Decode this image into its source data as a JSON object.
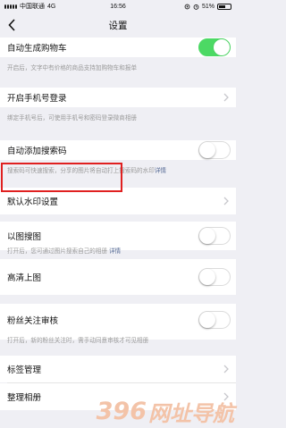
{
  "status": {
    "carrier": "中国联通",
    "network": "4G",
    "time": "16:56",
    "battery": "51%"
  },
  "nav": {
    "title": "设置"
  },
  "settings": [
    {
      "label": "自动生成购物车",
      "desc": "开启后，文字中有价格的商品支持加购物车和报单",
      "control": "toggle",
      "on": true
    },
    {
      "label": "开启手机号登录",
      "desc": "绑定手机号后，可使用手机号和密码登录微商相册",
      "control": "chevron"
    },
    {
      "label": "自动添加搜索码",
      "desc": "搜索码可快速搜索，分享的图片将自动打上搜索码的水印",
      "link": "详情",
      "control": "toggle",
      "on": false
    },
    {
      "label": "默认水印设置",
      "control": "chevron",
      "highlighted": true
    },
    {
      "label": "以图搜图",
      "desc": "打开后，您可通过图片搜索自己的相册",
      "link": "详情",
      "control": "toggle",
      "on": false
    },
    {
      "label": "高清上图",
      "control": "toggle",
      "on": false
    },
    {
      "label": "粉丝关注审核",
      "desc": "打开后，新的粉丝关注时，需手动同意审核才可见相册",
      "control": "toggle",
      "on": false
    },
    {
      "label": "标签管理",
      "control": "chevron"
    },
    {
      "label": "整理相册",
      "control": "chevron"
    }
  ],
  "watermark": {
    "digits": "396",
    "text": "网址导航"
  },
  "colors": {
    "toggle_on": "#4cd964",
    "highlight": "#e02020",
    "link": "#576b95"
  }
}
